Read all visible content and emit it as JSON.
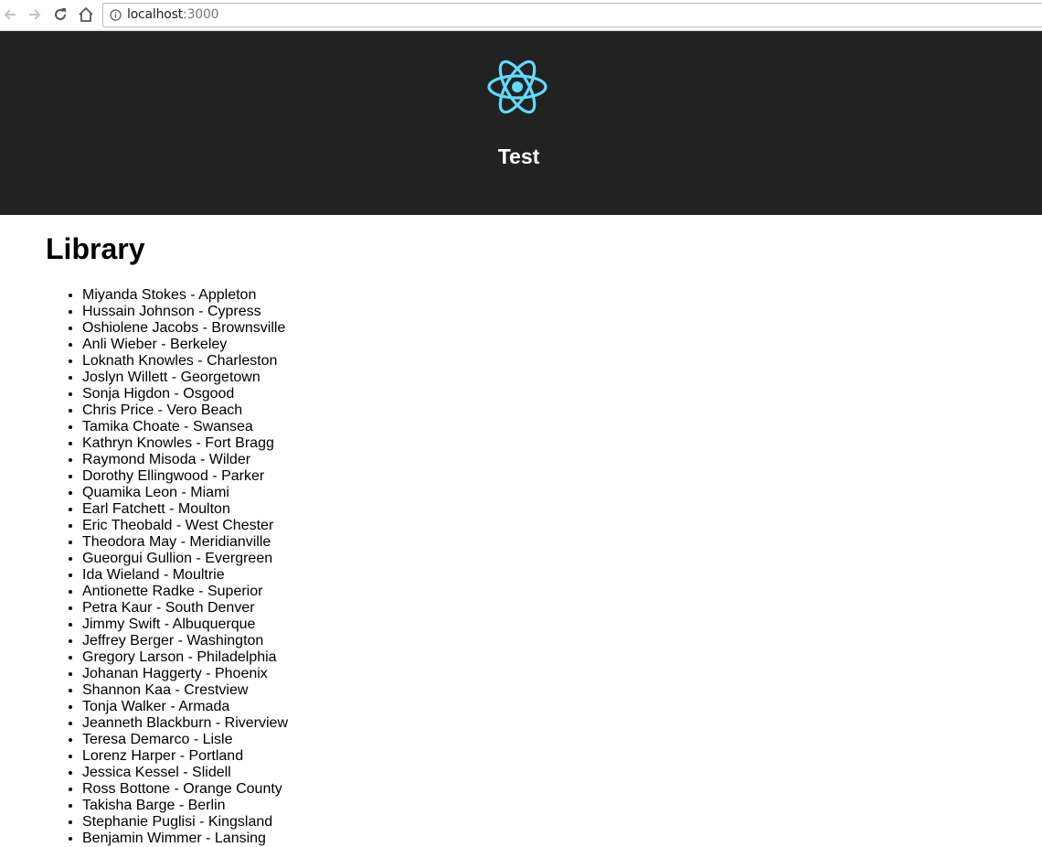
{
  "browser": {
    "url_host": "localhost",
    "url_port": ":3000"
  },
  "app": {
    "title": "Test",
    "logo_icon": "react-logo-icon",
    "header_bg": "#222222",
    "logo_color": "#61dafb"
  },
  "library": {
    "heading": "Library",
    "items": [
      "Miyanda Stokes - Appleton",
      "Hussain Johnson - Cypress",
      "Oshiolene Jacobs - Brownsville",
      "Anli Wieber - Berkeley",
      "Loknath Knowles - Charleston",
      "Joslyn Willett - Georgetown",
      "Sonja Higdon - Osgood",
      "Chris Price - Vero Beach",
      "Tamika Choate - Swansea",
      "Kathryn Knowles - Fort Bragg",
      "Raymond Misoda - Wilder",
      "Dorothy Ellingwood - Parker",
      "Quamika Leon - Miami",
      "Earl Fatchett - Moulton",
      "Eric Theobald - West Chester",
      "Theodora May - Meridianville",
      "Gueorgui Gullion - Evergreen",
      "Ida Wieland - Moultrie",
      "Antionette Radke - Superior",
      "Petra Kaur - South Denver",
      "Jimmy Swift - Albuquerque",
      "Jeffrey Berger - Washington",
      "Gregory Larson - Philadelphia",
      "Johanan Haggerty - Phoenix",
      "Shannon Kaa - Crestview",
      "Tonja Walker - Armada",
      "Jeanneth Blackburn - Riverview",
      "Teresa Demarco - Lisle",
      "Lorenz Harper - Portland",
      "Jessica Kessel - Slidell",
      "Ross Bottone - Orange County",
      "Takisha Barge - Berlin",
      "Stephanie Puglisi - Kingsland",
      "Benjamin Wimmer - Lansing"
    ]
  }
}
